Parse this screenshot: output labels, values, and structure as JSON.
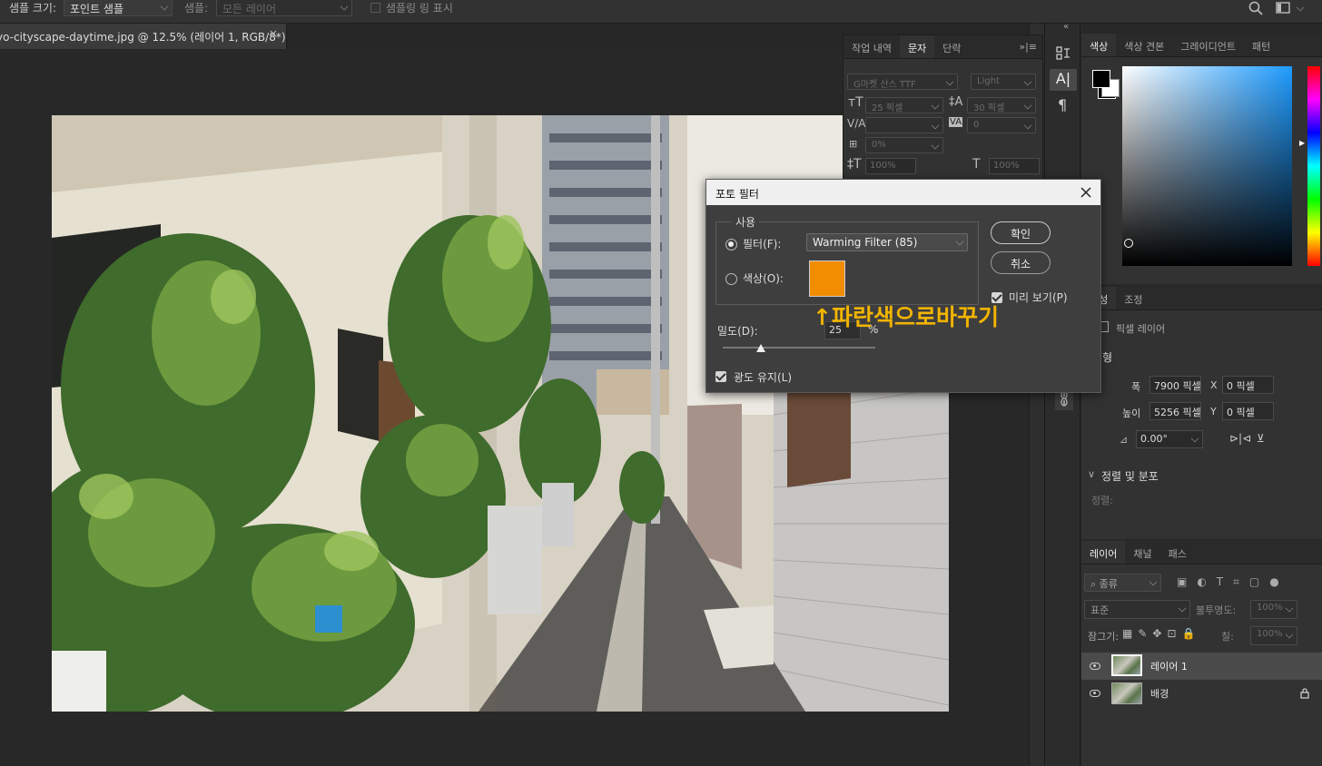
{
  "options_bar": {
    "sample_size_label": "샘플 크기:",
    "sample_size_value": "포인트 샘플",
    "sample_label": "샘플:",
    "sample_value": "모든 레이어",
    "show_ring_label": "샘플링 링 표시"
  },
  "document_tab": {
    "title": "yo-cityscape-daytime.jpg @ 12.5% (레이어 1, RGB/8*) *",
    "close": "×"
  },
  "character_panel": {
    "tabs": [
      "작업 내역",
      "문자",
      "단락"
    ],
    "active_tab": "문자",
    "font_family": "G마켓 산스 TTF",
    "font_style": "Light",
    "font_size": "25 픽셀",
    "leading": "30 픽셀",
    "kerning": "",
    "tracking": "0",
    "tsume": "0%",
    "vertical_scale": "100%",
    "horizontal_scale": "100%"
  },
  "photo_filter_dialog": {
    "title": "포토 필터",
    "use_group_label": "사용",
    "filter_label": "필터(F):",
    "filter_value": "Warming Filter (85)",
    "color_label": "색상(O):",
    "swatch_color": "#f28c00",
    "density_label": "밀도(D):",
    "density_value": "25",
    "density_unit": "%",
    "density_fraction": 0.25,
    "preserve_luminosity_label": "광도 유지(L)",
    "ok_label": "확인",
    "cancel_label": "취소",
    "preview_label": "미리 보기(P)"
  },
  "annotation": {
    "text": "↑파란색으로바꾸기",
    "color": "#f2b400"
  },
  "color_panel": {
    "tabs": [
      "색상",
      "색상 견본",
      "그레이디언트",
      "패턴"
    ],
    "active_tab": "색상"
  },
  "properties_panel": {
    "tabs": [
      "속성",
      "조정"
    ],
    "active_tab": "속성",
    "layer_type": "픽셀 레이어",
    "transform_section": "변형",
    "width_label": "폭",
    "width_value": "7900 픽셀",
    "height_label": "높이",
    "height_value": "5256 픽셀",
    "x_label": "X",
    "x_value": "0 픽셀",
    "y_label": "Y",
    "y_value": "0 픽셀",
    "angle_value": "0.00°",
    "align_section": "정렬 및 분포",
    "align_label": "정렬:"
  },
  "layers_panel": {
    "tabs": [
      "레이어",
      "채널",
      "패스"
    ],
    "active_tab": "레이어",
    "filter_kind": "종류",
    "blend_mode": "표준",
    "opacity_label": "불투명도:",
    "opacity_value": "100%",
    "lock_label": "잠그기:",
    "fill_label": "칠:",
    "fill_value": "100%",
    "layers": [
      {
        "name": "레이어 1",
        "selected": true,
        "locked": false
      },
      {
        "name": "배경",
        "selected": false,
        "locked": true
      }
    ]
  },
  "colors": {
    "app_bg": "#282828",
    "panel_bg": "#323232",
    "accent_orange": "#f28c00"
  }
}
